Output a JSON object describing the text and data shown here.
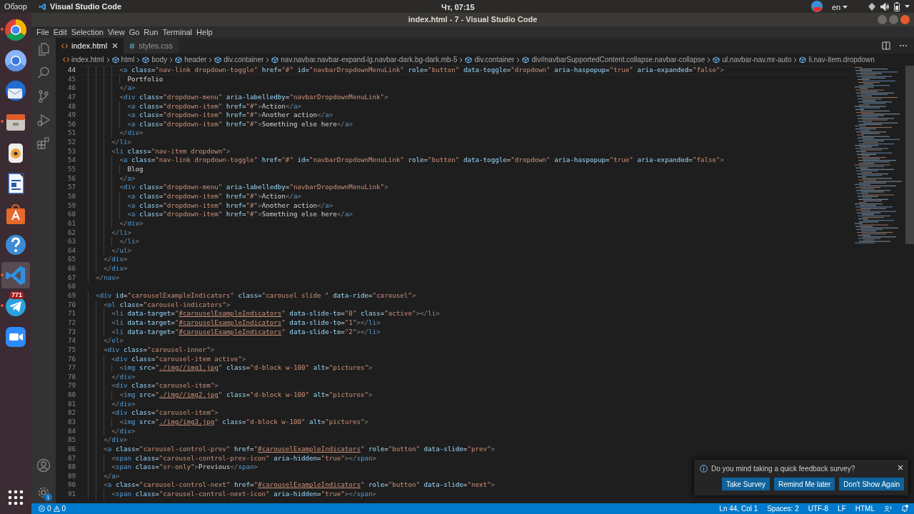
{
  "top_panel": {
    "activities": "Обзор",
    "app_menu": "Visual Studio Code",
    "clock": "Чт, 07:15",
    "language": "en"
  },
  "dock": {
    "apps": [
      {
        "kind": "chrome",
        "running": true,
        "selected": false
      },
      {
        "kind": "chromium",
        "running": false,
        "selected": false
      },
      {
        "kind": "mail",
        "running": false,
        "selected": false
      },
      {
        "kind": "files",
        "running": true,
        "selected": false
      },
      {
        "kind": "music",
        "running": false,
        "selected": false
      },
      {
        "kind": "document",
        "running": false,
        "selected": false
      },
      {
        "kind": "store",
        "running": false,
        "selected": false
      },
      {
        "kind": "help",
        "running": false,
        "selected": false
      },
      {
        "kind": "code",
        "running": true,
        "selected": true
      },
      {
        "kind": "telegram",
        "running": true,
        "selected": false,
        "badge": "771"
      },
      {
        "kind": "video",
        "running": false,
        "selected": false
      }
    ]
  },
  "window": {
    "title": "index.html - 7 - Visual Studio Code"
  },
  "menu": [
    "File",
    "Edit",
    "Selection",
    "View",
    "Go",
    "Run",
    "Terminal",
    "Help"
  ],
  "activity_bar": {
    "items": [
      {
        "kind": "files"
      },
      {
        "kind": "search"
      },
      {
        "kind": "branch"
      },
      {
        "kind": "run"
      },
      {
        "kind": "extensions"
      }
    ],
    "settings_badge": "1"
  },
  "tabs": [
    {
      "label": "index.html",
      "kind": "html",
      "selected": true
    },
    {
      "label": "styles.css",
      "kind": "css",
      "selected": false
    }
  ],
  "breadcrumbs": [
    {
      "label": "index.html",
      "kind": "file"
    },
    {
      "label": "html",
      "kind": "element"
    },
    {
      "label": "body",
      "kind": "element"
    },
    {
      "label": "header",
      "kind": "element"
    },
    {
      "label": "div.container",
      "kind": "element"
    },
    {
      "label": "nav.navbar.navbar-expand-lg.navbar-dark.bg-dark.mb-5",
      "kind": "element"
    },
    {
      "label": "div.container",
      "kind": "element"
    },
    {
      "label": "div#navbarSupportedContent.collapse.navbar-collapse",
      "kind": "element"
    },
    {
      "label": "ul.navbar-nav.mr-auto",
      "kind": "element"
    },
    {
      "label": "li.nav-item.dropdown",
      "kind": "element"
    }
  ],
  "editor": {
    "lines": [
      {
        "number": "44",
        "current": true,
        "text": "          <a class=\"nav-link dropdown-toggle\" href=\"#\" id=\"navbarDropdownMenuLink\" role=\"button\" data-toggle=\"dropdown\" aria-haspopup=\"true\" aria-expanded=\"false\">"
      },
      {
        "number": "45",
        "current": false,
        "text": "            Portfolio"
      },
      {
        "number": "46",
        "current": false,
        "text": "          </a>"
      },
      {
        "number": "47",
        "current": false,
        "text": "          <div class=\"dropdown-menu\" aria-labelledby=\"navbarDropdownMenuLink\">"
      },
      {
        "number": "48",
        "current": false,
        "text": "            <a class=\"dropdown-item\" href=\"#\">Action</a>"
      },
      {
        "number": "49",
        "current": false,
        "text": "            <a class=\"dropdown-item\" href=\"#\">Another action</a>"
      },
      {
        "number": "50",
        "current": false,
        "text": "            <a class=\"dropdown-item\" href=\"#\">Something else here</a>"
      },
      {
        "number": "51",
        "current": false,
        "text": "          </div>"
      },
      {
        "number": "52",
        "current": false,
        "text": "        </li>"
      },
      {
        "number": "53",
        "current": false,
        "text": "        <li class=\"nav-item dropdown\">"
      },
      {
        "number": "54",
        "current": false,
        "text": "          <a class=\"nav-link dropdown-toggle\" href=\"#\" id=\"navbarDropdownMenuLink\" role=\"button\" data-toggle=\"dropdown\" aria-haspopup=\"true\" aria-expanded=\"false\">"
      },
      {
        "number": "55",
        "current": false,
        "text": "            Blog"
      },
      {
        "number": "56",
        "current": false,
        "text": "          </a>"
      },
      {
        "number": "57",
        "current": false,
        "text": "          <div class=\"dropdown-menu\" aria-labelledby=\"navbarDropdownMenuLink\">"
      },
      {
        "number": "58",
        "current": false,
        "text": "            <a class=\"dropdown-item\" href=\"#\">Action</a>"
      },
      {
        "number": "59",
        "current": false,
        "text": "            <a class=\"dropdown-item\" href=\"#\">Another action</a>"
      },
      {
        "number": "60",
        "current": false,
        "text": "            <a class=\"dropdown-item\" href=\"#\">Something else here</a>"
      },
      {
        "number": "61",
        "current": false,
        "text": "          </div>"
      },
      {
        "number": "62",
        "current": false,
        "text": "        </li>"
      },
      {
        "number": "63",
        "current": false,
        "text": "          </li>"
      },
      {
        "number": "64",
        "current": false,
        "text": "        </ul>"
      },
      {
        "number": "65",
        "current": false,
        "text": "      </div>"
      },
      {
        "number": "66",
        "current": false,
        "text": "      </div>"
      },
      {
        "number": "67",
        "current": false,
        "text": "    </nav>"
      },
      {
        "number": "68",
        "current": false
      },
      {
        "number": "69",
        "current": false,
        "text": "    <div id=\"carouselExampleIndicators\" class=\"carousel slide \" data-ride=\"carousel\">"
      },
      {
        "number": "70",
        "current": false,
        "text": "      <ol class=\"carousel-indicators\">"
      },
      {
        "number": "71",
        "current": false,
        "text": "        <li data-target=\"#carouselExampleIndicators\" data-slide-to=\"0\" class=\"active\"></li>"
      },
      {
        "number": "72",
        "current": false,
        "text": "        <li data-target=\"#carouselExampleIndicators\" data-slide-to=\"1\"></li>"
      },
      {
        "number": "73",
        "current": false,
        "text": "        <li data-target=\"#carouselExampleIndicators\" data-slide-to=\"2\"></li>"
      },
      {
        "number": "74",
        "current": false,
        "text": "      </ol>"
      },
      {
        "number": "75",
        "current": false,
        "text": "      <div class=\"carousel-inner\">"
      },
      {
        "number": "76",
        "current": false,
        "text": "        <div class=\"carousel-item active\">"
      },
      {
        "number": "77",
        "current": false,
        "text": "          <img src=\"./img//img1.jpg\" class=\"d-block w-100\" alt=\"pictures\">"
      },
      {
        "number": "78",
        "current": false,
        "text": "        </div>"
      },
      {
        "number": "79",
        "current": false,
        "text": "        <div class=\"carousel-item\">"
      },
      {
        "number": "80",
        "current": false,
        "text": "          <img src=\"./img//img2.jpg\" class=\"d-block w-100\" alt=\"pictures\">"
      },
      {
        "number": "81",
        "current": false,
        "text": "        </div>"
      },
      {
        "number": "82",
        "current": false,
        "text": "        <div class=\"carousel-item\">"
      },
      {
        "number": "83",
        "current": false,
        "text": "          <img src=\"./img/img3.jpg\" class=\"d-block w-100\" alt=\"pictures\">"
      },
      {
        "number": "84",
        "current": false,
        "text": "        </div>"
      },
      {
        "number": "85",
        "current": false,
        "text": "      </div>"
      },
      {
        "number": "86",
        "current": false,
        "text": "      <a class=\"carousel-control-prev\" href=\"#carouselExampleIndicators\" role=\"button\" data-slide=\"prev\">"
      },
      {
        "number": "87",
        "current": false,
        "text": "        <span class=\"carousel-control-prev-icon\" aria-hidden=\"true\"></span>"
      },
      {
        "number": "88",
        "current": false,
        "text": "        <span class=\"sr-only\">Previous</span>"
      },
      {
        "number": "89",
        "current": false,
        "text": "      </a>"
      },
      {
        "number": "90",
        "current": false,
        "text": "      <a class=\"carousel-control-next\" href=\"#carouselExampleIndicators\" role=\"button\" data-slide=\"next\">"
      },
      {
        "number": "91",
        "current": false,
        "text": "        <span class=\"carousel-control-next-icon\" aria-hidden=\"true\"></span>"
      }
    ]
  },
  "notification": {
    "message": "Do you mind taking a quick feedback survey?",
    "buttons": [
      "Take Survey",
      "Remind Me later",
      "Don't Show Again"
    ]
  },
  "status_bar": {
    "errors": "0",
    "warnings": "0",
    "items": [
      "Ln 44, Col 1",
      "Spaces: 2",
      "UTF-8",
      "LF",
      "HTML"
    ]
  }
}
